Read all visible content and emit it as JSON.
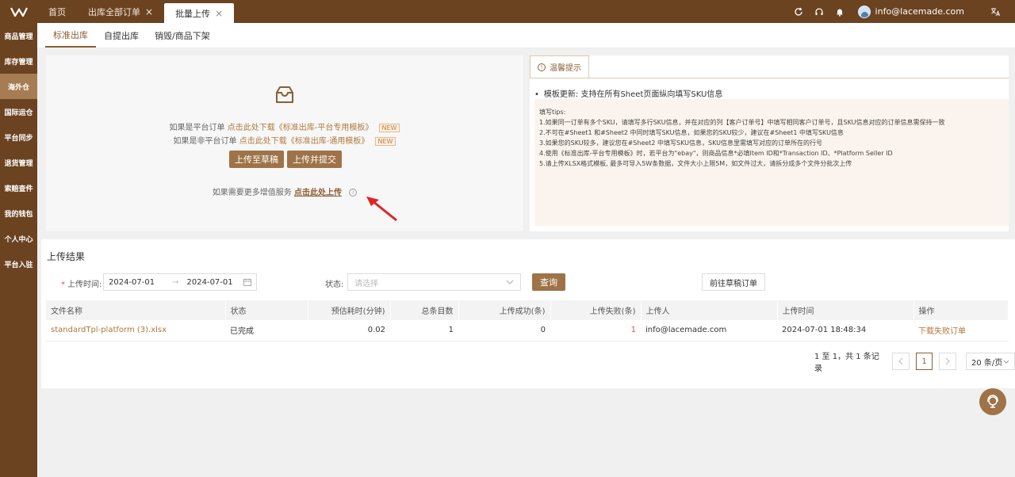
{
  "topbar": {
    "tabs": [
      {
        "label": "首页"
      },
      {
        "label": "出库全部订单",
        "closable": true
      },
      {
        "label": "批量上传",
        "closable": true,
        "active": true
      }
    ],
    "close_glyph": "×",
    "user_email": "info@lacemade.com",
    "icons": [
      "refresh-icon",
      "headset-icon",
      "bell-icon",
      "translate-icon"
    ]
  },
  "sidebar": {
    "items": [
      "商品管理",
      "库存管理",
      "海外仓",
      "国际运仓",
      "平台同步",
      "退货管理",
      "索赔查件",
      "我的钱包",
      "个人中心",
      "平台入驻"
    ],
    "active_index": 2
  },
  "subtabs": [
    "标准出库",
    "自提出库",
    "销毁/商品下架"
  ],
  "upload": {
    "line1_prefix": "如果是平台订单",
    "line1_link": "点击此处下载《标准出库-平台专用模板》",
    "line2_prefix": "如果是非平台订单",
    "line2_link": "点击此处下载《标准出库-通用模板》",
    "badge": "NEW",
    "btn_draft": "上传至草稿",
    "btn_submit": "上传并提交",
    "more_prefix": "如果需要更多增值服务",
    "more_link": "点击此处上传"
  },
  "tips": {
    "tab_label": "温馨提示",
    "update": "模板更新: 支持在所有Sheet页面纵向填写SKU信息",
    "title": "填写tips:",
    "lines": [
      "1.如果同一订单有多个SKU，请填写多行SKU信息，并在对应的列【客户订单号】中填写相同客户订单号，且SKU信息对应的订单信息需保持一致",
      "2.不可在#Sheet1 和#Sheet2 中同时填写SKU信息，如果您的SKU较少，建议在#Sheet1 中填写SKU信息",
      "3.如果您的SKU较多，建议您在#Sheet2 中填写SKU信息，SKU信息里需填写对应的订单所在的行号",
      "4.使用《标准出库-平台专用模板》时，若平台为\"ebay\"，则商品信息*必填Item ID和*Transaction ID、*Platform Seller ID",
      "5.请上传XLSX格式模板, 最多可导入5W条数据，文件大小上限5M，如文件过大，请拆分成多个文件分批次上传"
    ]
  },
  "results": {
    "title": "上传结果",
    "time_label": "上传时间:",
    "date_start": "2024-07-01",
    "date_end": "2024-07-01",
    "date_sep": "→",
    "status_label": "状态:",
    "status_placeholder": "请选择",
    "btn_search": "查询",
    "btn_draft_orders": "前往草稿订单",
    "columns": [
      "文件名称",
      "状态",
      "预估耗时(分钟)",
      "总条目数",
      "上传成功(条)",
      "上传失败(条)",
      "上传人",
      "上传时间",
      "操作"
    ],
    "rows": [
      {
        "file": "standardTpl-platform (3).xlsx",
        "status": "已完成",
        "est": "0.02",
        "total": "1",
        "success": "0",
        "fail": "1",
        "uploader": "info@lacemade.com",
        "time": "2024-07-01 18:48:34",
        "action": "下载失败订单"
      }
    ],
    "pagination": {
      "summary": "1 至 1，共 1 条记录",
      "page": "1",
      "page_size": "20 条/页"
    }
  },
  "colors": {
    "brand": "#6b4321",
    "accent": "#9e7347",
    "sidebar_active": "#a67c52"
  }
}
